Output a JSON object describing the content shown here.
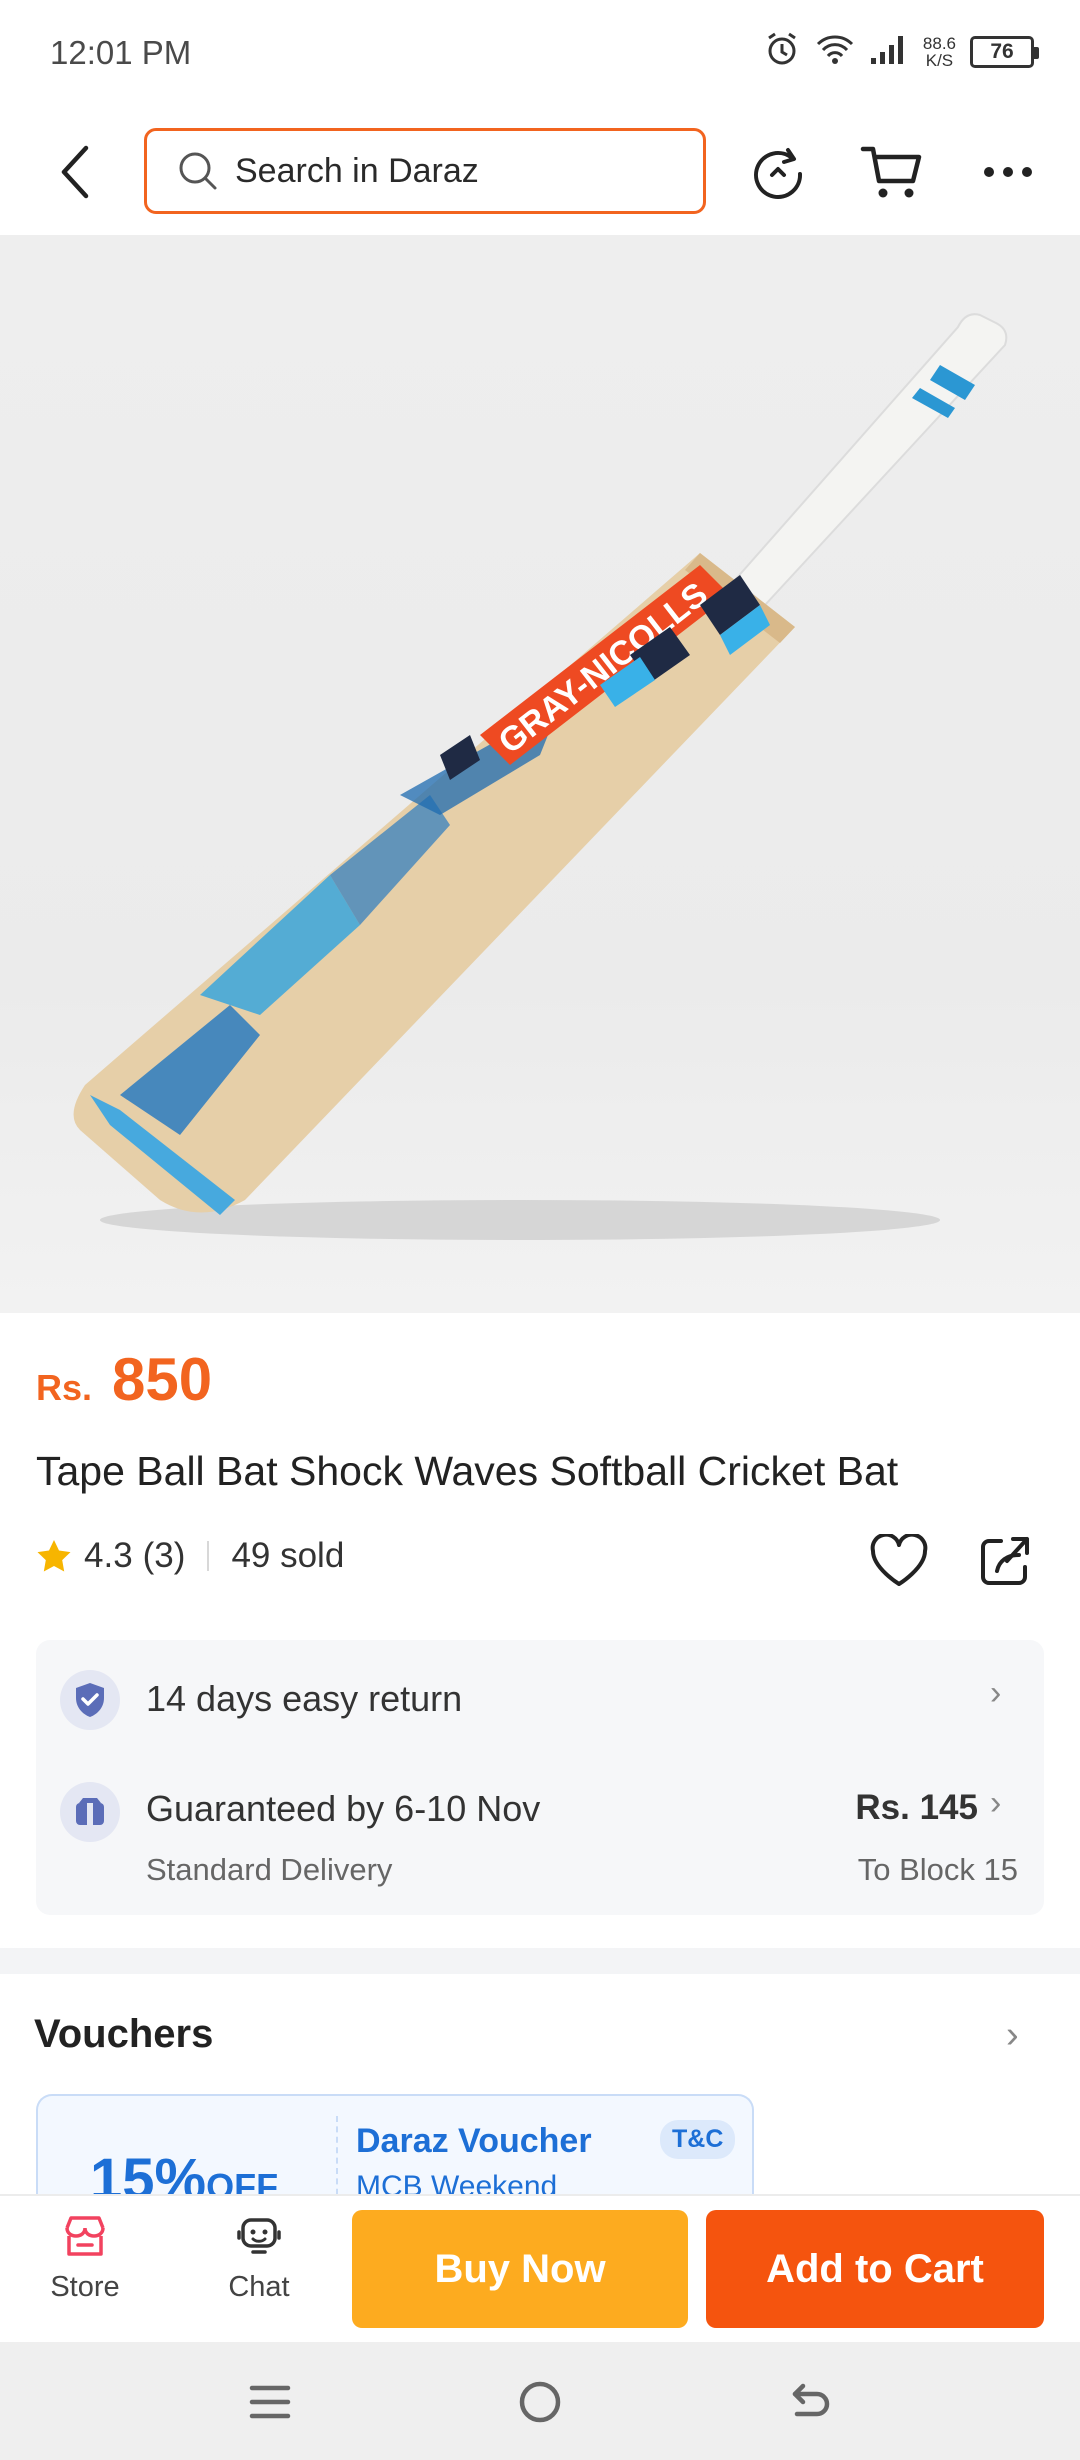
{
  "status_bar": {
    "time": "12:01 PM",
    "net_speed_value": "88.6",
    "net_speed_unit": "K/S",
    "battery": "76"
  },
  "header": {
    "search_placeholder": "Search in Daraz"
  },
  "product": {
    "currency": "Rs.",
    "price": "850",
    "title": "Tape Ball Bat Shock Waves Softball Cricket Bat",
    "rating": "4.3",
    "rating_count": "(3)",
    "sold": "49 sold",
    "image_brand_text": "GRAY-NICOLLS"
  },
  "services": {
    "return_label": "14 days easy return",
    "delivery_label": "Guaranteed by 6-10 Nov",
    "delivery_type": "Standard Delivery",
    "delivery_price": "Rs. 145",
    "delivery_destination": "To Block 15"
  },
  "vouchers": {
    "title": "Vouchers",
    "card": {
      "discount": "15%",
      "discount_suffix": "OFF",
      "name": "Daraz Voucher",
      "subtitle": "MCB Weekend",
      "badge": "T&C"
    }
  },
  "action_bar": {
    "store_label": "Store",
    "chat_label": "Chat",
    "buy_now_label": "Buy Now",
    "add_to_cart_label": "Add to Cart"
  },
  "colors": {
    "accent": "#f2641f",
    "buy_now": "#fdab1f",
    "add_to_cart": "#f5540e",
    "voucher_blue": "#1d6fd6",
    "star": "#f7b500"
  }
}
